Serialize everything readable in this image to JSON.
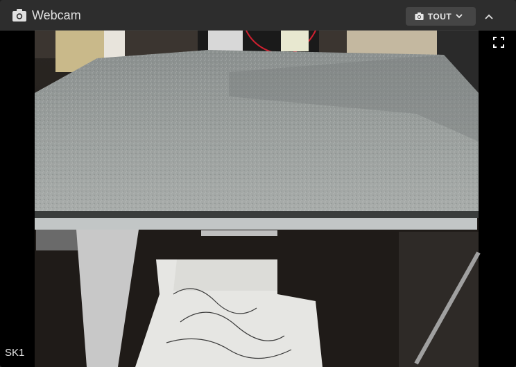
{
  "header": {
    "title": "Webcam",
    "title_icon": "camera-icon",
    "camera_select_label": "TOUT",
    "camera_select_icon": "camera-icon",
    "collapse_icon": "chevron-up-icon"
  },
  "feed": {
    "fullscreen_icon": "fullscreen-icon",
    "camera_name": "SK1"
  },
  "colors": {
    "header_bg": "#2d2d2d",
    "panel_bg": "#1e1e1e",
    "button_bg": "#454545",
    "text": "#e0e0e0"
  }
}
